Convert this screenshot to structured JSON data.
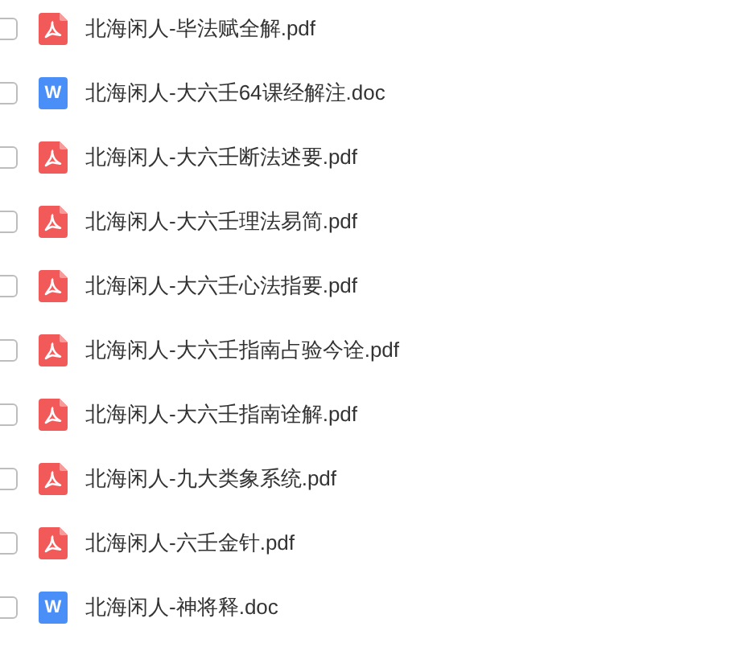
{
  "files": [
    {
      "kind": "pdf",
      "name": "北海闲人-毕法赋全解.pdf",
      "checked": false
    },
    {
      "kind": "doc",
      "badge": "W",
      "name": "北海闲人-大六壬64课经解注.doc",
      "checked": false
    },
    {
      "kind": "pdf",
      "name": "北海闲人-大六壬断法述要.pdf",
      "checked": false
    },
    {
      "kind": "pdf",
      "name": "北海闲人-大六壬理法易简.pdf",
      "checked": false
    },
    {
      "kind": "pdf",
      "name": "北海闲人-大六壬心法指要.pdf",
      "checked": false
    },
    {
      "kind": "pdf",
      "name": "北海闲人-大六壬指南占验今诠.pdf",
      "checked": false
    },
    {
      "kind": "pdf",
      "name": "北海闲人-大六壬指南诠解.pdf",
      "checked": false
    },
    {
      "kind": "pdf",
      "name": "北海闲人-九大类象系统.pdf",
      "checked": false
    },
    {
      "kind": "pdf",
      "name": "北海闲人-六壬金针.pdf",
      "checked": false
    },
    {
      "kind": "doc",
      "badge": "W",
      "name": "北海闲人-神将释.doc",
      "checked": false
    }
  ]
}
